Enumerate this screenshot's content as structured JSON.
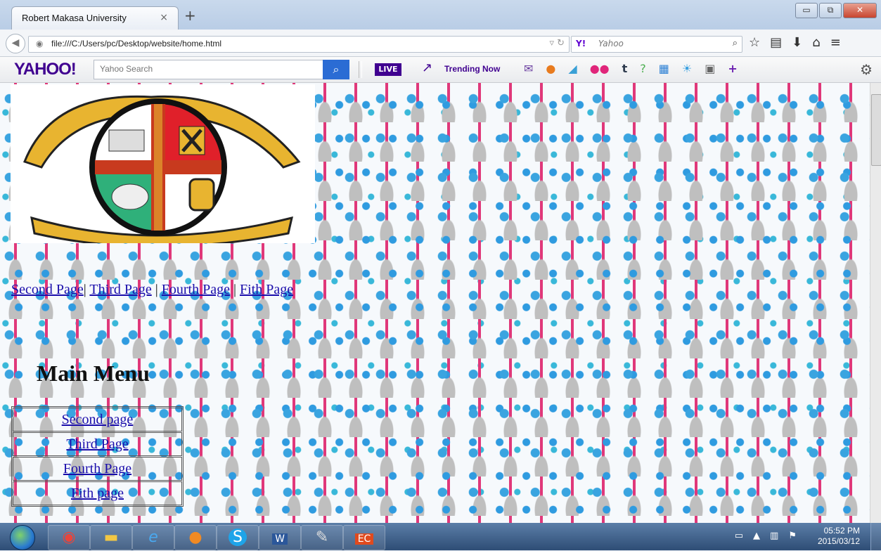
{
  "browser": {
    "tab_title": "Robert Makasa University",
    "tab_close": "×",
    "new_tab": "+",
    "url": "file:///C:/Users/pc/Desktop/website/home.html",
    "search_brand": "Y!",
    "search_placeholder": "Yahoo",
    "window_buttons": [
      "▭",
      "⧉",
      "✕"
    ]
  },
  "yahoo_bar": {
    "logo": "YAHOO!",
    "search_placeholder": "Yahoo Search",
    "live_label": "LIVE",
    "trending_label": "Trending Now"
  },
  "page": {
    "nav_links": [
      "Second Page",
      "Third Page",
      "Fourth Page",
      "Fith Page"
    ],
    "nav_separator": "|",
    "main_title": "Main Menu",
    "menu_items": [
      "Second page",
      "Third Page",
      "Fourth Page",
      "Fith page"
    ]
  },
  "taskbar": {
    "time": "05:52 PM",
    "date": "2015/03/12"
  },
  "colors": {
    "link": "#1a0dab",
    "yahoo_purple": "#400090",
    "taskbar": "#2e4d75"
  }
}
